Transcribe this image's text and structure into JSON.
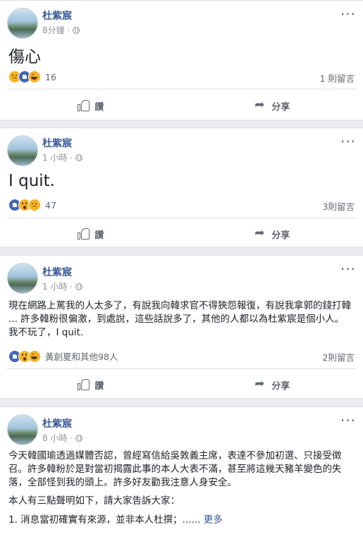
{
  "posts": [
    {
      "author": "杜紫宸",
      "time": "8分鐘 ·",
      "text": "傷心",
      "reaction_count": "16",
      "comments": "1 則留言",
      "reactions": [
        "sad",
        "like",
        "haha"
      ]
    },
    {
      "author": "杜紫宸",
      "time": "1 小時 ·",
      "text": "I quit.",
      "reaction_count": "47",
      "comments": "3則留言",
      "reactions": [
        "like",
        "wow",
        "sad"
      ]
    },
    {
      "author": "杜紫宸",
      "time": "1 小時 ·",
      "text": "現在網路上罵我的人太多了，有說我向韓求官不得狹怨報復，有說我拿郭的錢打韓 ... 許多韓粉很偏激，到處說，這些話說多了，其他的人都以為杜紫宸是個小人。我不玩了，I quit.",
      "reaction_count": "黃創夏和其他98人",
      "comments": "2則留言",
      "reactions": [
        "like",
        "wow",
        "haha"
      ]
    },
    {
      "author": "杜紫宸",
      "time": "8 小時 ·",
      "text_p1": "今天韓國瑜透過媒體否認，曾經寫信給吳敦義主席，表達不參加初選、只接受徵召。許多韓粉於是對當初揭露此事的本人大表不滿，甚至將這幾天豬羊變色的失落，全部怪到我的頭上。許多好友勸我注意人身安全。",
      "text_p2": "本人有三點聲明如下，請大家告訴大家：",
      "text_p3": "1. 消息當初確實有來源，並非本人杜撰；......",
      "more": "更多"
    }
  ],
  "actions": {
    "like": "讚",
    "share": "分享"
  },
  "more_icon": "···"
}
